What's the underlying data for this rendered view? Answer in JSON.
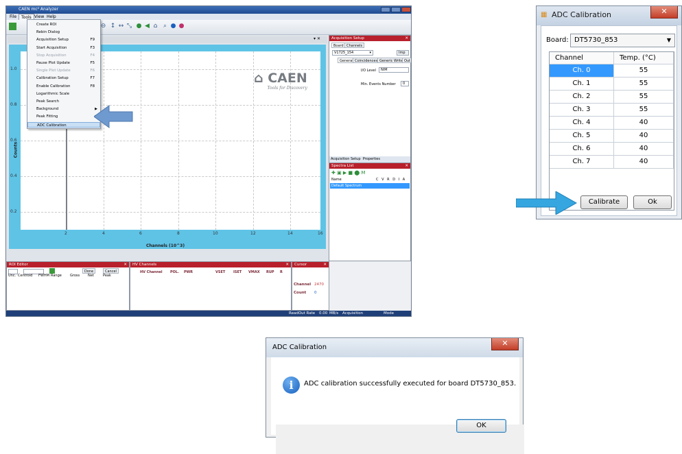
{
  "app": {
    "title": "CAEN mc² Analyzer",
    "menu": [
      "File",
      "Tools",
      "View",
      "Help"
    ],
    "tools_menu": [
      {
        "label": "Create ROI",
        "shortcut": "",
        "disabled": false,
        "submenu": false
      },
      {
        "label": "Rebin Dialog",
        "shortcut": "",
        "disabled": false,
        "submenu": false
      },
      {
        "label": "Acquisition Setup",
        "shortcut": "F9",
        "disabled": false,
        "submenu": false
      },
      {
        "label": "Start Acquisition",
        "shortcut": "F3",
        "disabled": false,
        "submenu": false
      },
      {
        "label": "Stop Acquisition",
        "shortcut": "F4",
        "disabled": true,
        "submenu": false
      },
      {
        "label": "Pause Plot Update",
        "shortcut": "F5",
        "disabled": false,
        "submenu": false
      },
      {
        "label": "Single Plot Update",
        "shortcut": "F6",
        "disabled": true,
        "submenu": false
      },
      {
        "label": "Calibration Setup",
        "shortcut": "F7",
        "disabled": false,
        "submenu": false
      },
      {
        "label": "Enable Calibration",
        "shortcut": "F8",
        "disabled": false,
        "submenu": false
      },
      {
        "label": "Logarithmic Scale",
        "shortcut": "",
        "disabled": false,
        "submenu": false
      },
      {
        "label": "Peak Search",
        "shortcut": "",
        "disabled": false,
        "submenu": false
      },
      {
        "label": "Background",
        "shortcut": "",
        "disabled": false,
        "submenu": true
      },
      {
        "label": "Peak Fitting",
        "shortcut": "",
        "disabled": false,
        "submenu": true
      },
      {
        "label": "ADC Calibration",
        "shortcut": "",
        "disabled": false,
        "submenu": false,
        "selected": true
      }
    ],
    "plot": {
      "logo": "CAEN",
      "logo_tagline": "Tools for Discovery",
      "y_ticks": [
        "1.0",
        "0.8",
        "0.6",
        "0.4",
        "0.2"
      ],
      "x_ticks": [
        "2",
        "4",
        "6",
        "8",
        "10",
        "12",
        "14",
        "16"
      ],
      "xlabel": "Channels (10^3)",
      "ylabel": "Counts"
    },
    "acq_setup": {
      "title": "Acquisition Setup",
      "tabs": [
        "Board",
        "Channels"
      ],
      "board_value": "V1725_154",
      "import_label": "Imp",
      "subtabs": [
        "General",
        "Coincidences",
        "Generic Writes",
        "Out"
      ],
      "io_level_label": "I/O Level",
      "io_level_value": "NIM",
      "min_events_label": "Min. Events Number",
      "min_events_value": "0",
      "bottom_tabs": [
        "Acquisition Setup",
        "Properties"
      ]
    },
    "spectra_list": {
      "title": "Spectra List",
      "columns": [
        "Name",
        "C",
        "V",
        "R",
        "D",
        "I",
        "A"
      ],
      "row": "Default Spectrum"
    },
    "roi_editor": {
      "title": "ROI Editor",
      "done_label": "Done",
      "cancel_label": "Cancel",
      "columns": [
        "Unc.",
        "Centroid",
        "FWHM",
        "Range",
        "Gross",
        "Net",
        "Peak"
      ]
    },
    "hv_channels": {
      "title": "HV Channels",
      "columns": [
        "HV Channel",
        "POL.",
        "PWR",
        "VSET",
        "ISET",
        "VMAX",
        "RUP",
        "R"
      ]
    },
    "cursor": {
      "title": "Cursor",
      "channel_label": "Channel",
      "channel_value": "2470",
      "count_label": "Count",
      "count_value": "0"
    },
    "status": {
      "readout_label": "ReadOut Rate",
      "readout_value": "0.00",
      "readout_unit": "MB/s",
      "acquisition_label": "Acquisition",
      "mode_label": "Mode"
    }
  },
  "calib_dialog": {
    "title": "ADC Calibration",
    "board_label": "Board:",
    "board_value": "DT5730_853",
    "columns": [
      "Channel",
      "Temp. (°C)"
    ],
    "rows": [
      {
        "channel": "Ch. 0",
        "temp": "55",
        "selected": true
      },
      {
        "channel": "Ch. 1",
        "temp": "55"
      },
      {
        "channel": "Ch. 2",
        "temp": "55"
      },
      {
        "channel": "Ch. 3",
        "temp": "55"
      },
      {
        "channel": "Ch. 4",
        "temp": "40"
      },
      {
        "channel": "Ch. 5",
        "temp": "40"
      },
      {
        "channel": "Ch. 6",
        "temp": "40"
      },
      {
        "channel": "Ch. 7",
        "temp": "40"
      }
    ],
    "calibrate_label": "Calibrate",
    "ok_label": "Ok"
  },
  "message_box": {
    "title": "ADC Calibration",
    "message": "ADC calibration successfully executed for board DT5730_853.",
    "ok_label": "OK"
  },
  "colors": {
    "highlight_arrow": "#35a6e0",
    "menu_arrow": "#6f9ad0",
    "plot_border": "#5fc3e6",
    "panel_header": "#b8202b",
    "selection": "#3399ff"
  }
}
